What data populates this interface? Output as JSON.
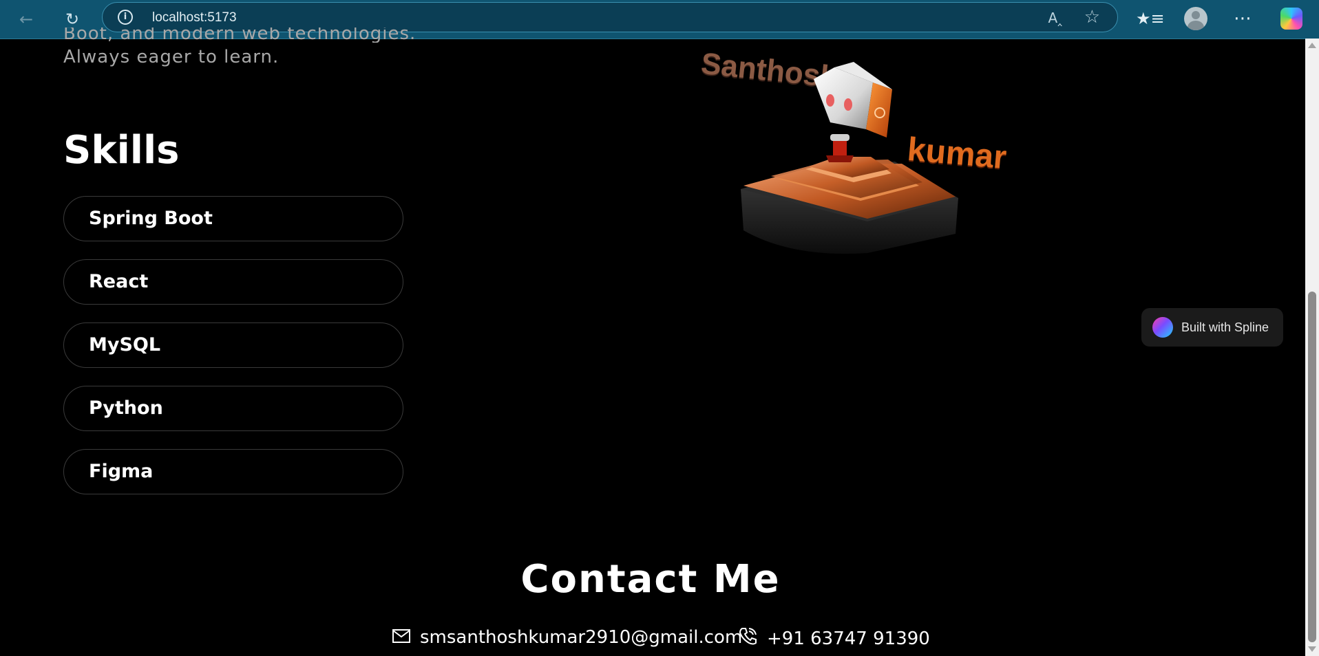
{
  "browser": {
    "url": "localhost:5173"
  },
  "intro": {
    "partial_line": "Boot, and modern web technologies.",
    "line": "Always eager to learn."
  },
  "skills": {
    "heading": "Skills",
    "items": [
      "Spring Boot",
      "React",
      "MySQL",
      "Python",
      "Figma"
    ]
  },
  "scene": {
    "first_name": "Santhosh",
    "last_name": "kumar"
  },
  "spline_badge": {
    "label": "Built with Spline"
  },
  "contact": {
    "heading": "Contact Me",
    "email": "smsanthoshkumar2910@gmail.com",
    "phone": "+91 63747 91390"
  },
  "icons": {
    "back": "back-arrow-icon",
    "refresh": "refresh-icon",
    "info": "info-icon",
    "read_aloud": "read-aloud-icon",
    "favorite": "star-icon",
    "favorites_list": "favorites-icon",
    "profile": "avatar",
    "more": "more-icon",
    "copilot": "copilot-icon",
    "email": "mail-icon",
    "phone": "phone-icon"
  },
  "colors": {
    "page_bg": "#000000",
    "chrome_bg": "#0f5470",
    "accent_orange": "#e06b1f"
  }
}
